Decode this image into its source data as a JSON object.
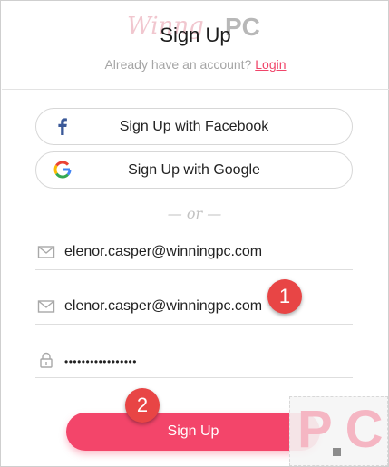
{
  "header": {
    "watermark_script": "Winng",
    "watermark_pc": "PC",
    "title": "Sign Up",
    "already_text": "Already have an account?",
    "login_link": "Login"
  },
  "social": {
    "facebook_label": "Sign Up with Facebook",
    "google_label": "Sign Up with Google"
  },
  "divider": "— or —",
  "fields": {
    "email": "elenor.casper@winningpc.com",
    "confirm_email": "elenor.casper@winningpc.com",
    "password": "•••••••••••••••••"
  },
  "badges": {
    "one": "1",
    "two": "2"
  },
  "submit_label": "Sign Up",
  "corner_logo": "PC",
  "colors": {
    "accent": "#f3456a",
    "badge": "#e84545",
    "facebook": "#3b5998"
  }
}
